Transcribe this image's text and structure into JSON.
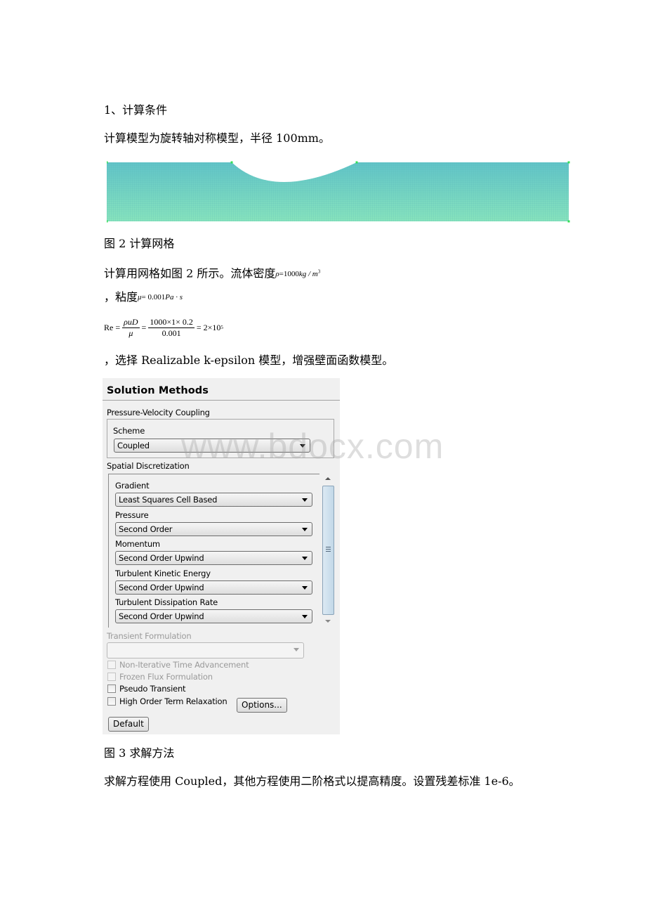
{
  "document": {
    "section_heading": "1、计算条件",
    "para_model": "计算模型为旋转轴对称模型，半径 100mm。",
    "fig2_caption": "图 2 计算网格",
    "para_mesh_prefix": "计算用网格如图 2 所示。流体密度",
    "density_formula": {
      "symbol": "ρ",
      "eq": "=1000",
      "unit": "kg / m",
      "exp": "3"
    },
    "para_viscosity_prefix": "，粘度",
    "viscosity_formula": {
      "symbol": "μ",
      "eq": "= 0.001",
      "unit": "Pa · s"
    },
    "reynolds": {
      "lhs": "Re =",
      "frac1_num": "ρuD",
      "frac1_den": "μ",
      "eq2": "=",
      "frac2_num": "1000×1× 0.2",
      "frac2_den": "0.001",
      "result": "= 2×10",
      "result_exp": "5"
    },
    "para_turbulence": "，选择 Realizable k-epsilon 模型，增强壁面函数模型。",
    "fig3_caption": "图 3 求解方法",
    "para_solver": "求解方程使用 Coupled，其他方程使用二阶格式以提高精度。设置残差标准 1e-6。",
    "watermark": "www.bdocx.com"
  },
  "mesh": {
    "colors": {
      "top": "#5fc2c8",
      "bottom": "#8ae6bc",
      "nodes": "#33e055"
    }
  },
  "panel": {
    "title": "Solution Methods",
    "pv_coupling_label": "Pressure-Velocity Coupling",
    "scheme_label": "Scheme",
    "scheme_value": "Coupled",
    "spatial_label": "Spatial Discretization",
    "fields": [
      {
        "label": "Gradient",
        "value": "Least Squares Cell Based"
      },
      {
        "label": "Pressure",
        "value": "Second Order"
      },
      {
        "label": "Momentum",
        "value": "Second Order Upwind"
      },
      {
        "label": "Turbulent Kinetic Energy",
        "value": "Second Order Upwind"
      },
      {
        "label": "Turbulent Dissipation Rate",
        "value": "Second Order Upwind"
      }
    ],
    "transient_label": "Transient Formulation",
    "transient_value": "",
    "checkboxes": [
      {
        "label": "Non-Iterative Time Advancement",
        "checked": false,
        "disabled": true
      },
      {
        "label": "Frozen Flux Formulation",
        "checked": false,
        "disabled": true
      },
      {
        "label": "Pseudo Transient",
        "checked": false,
        "disabled": false
      },
      {
        "label": "High Order Term Relaxation",
        "checked": false,
        "disabled": false
      }
    ],
    "options_button": "Options...",
    "default_button": "Default"
  }
}
